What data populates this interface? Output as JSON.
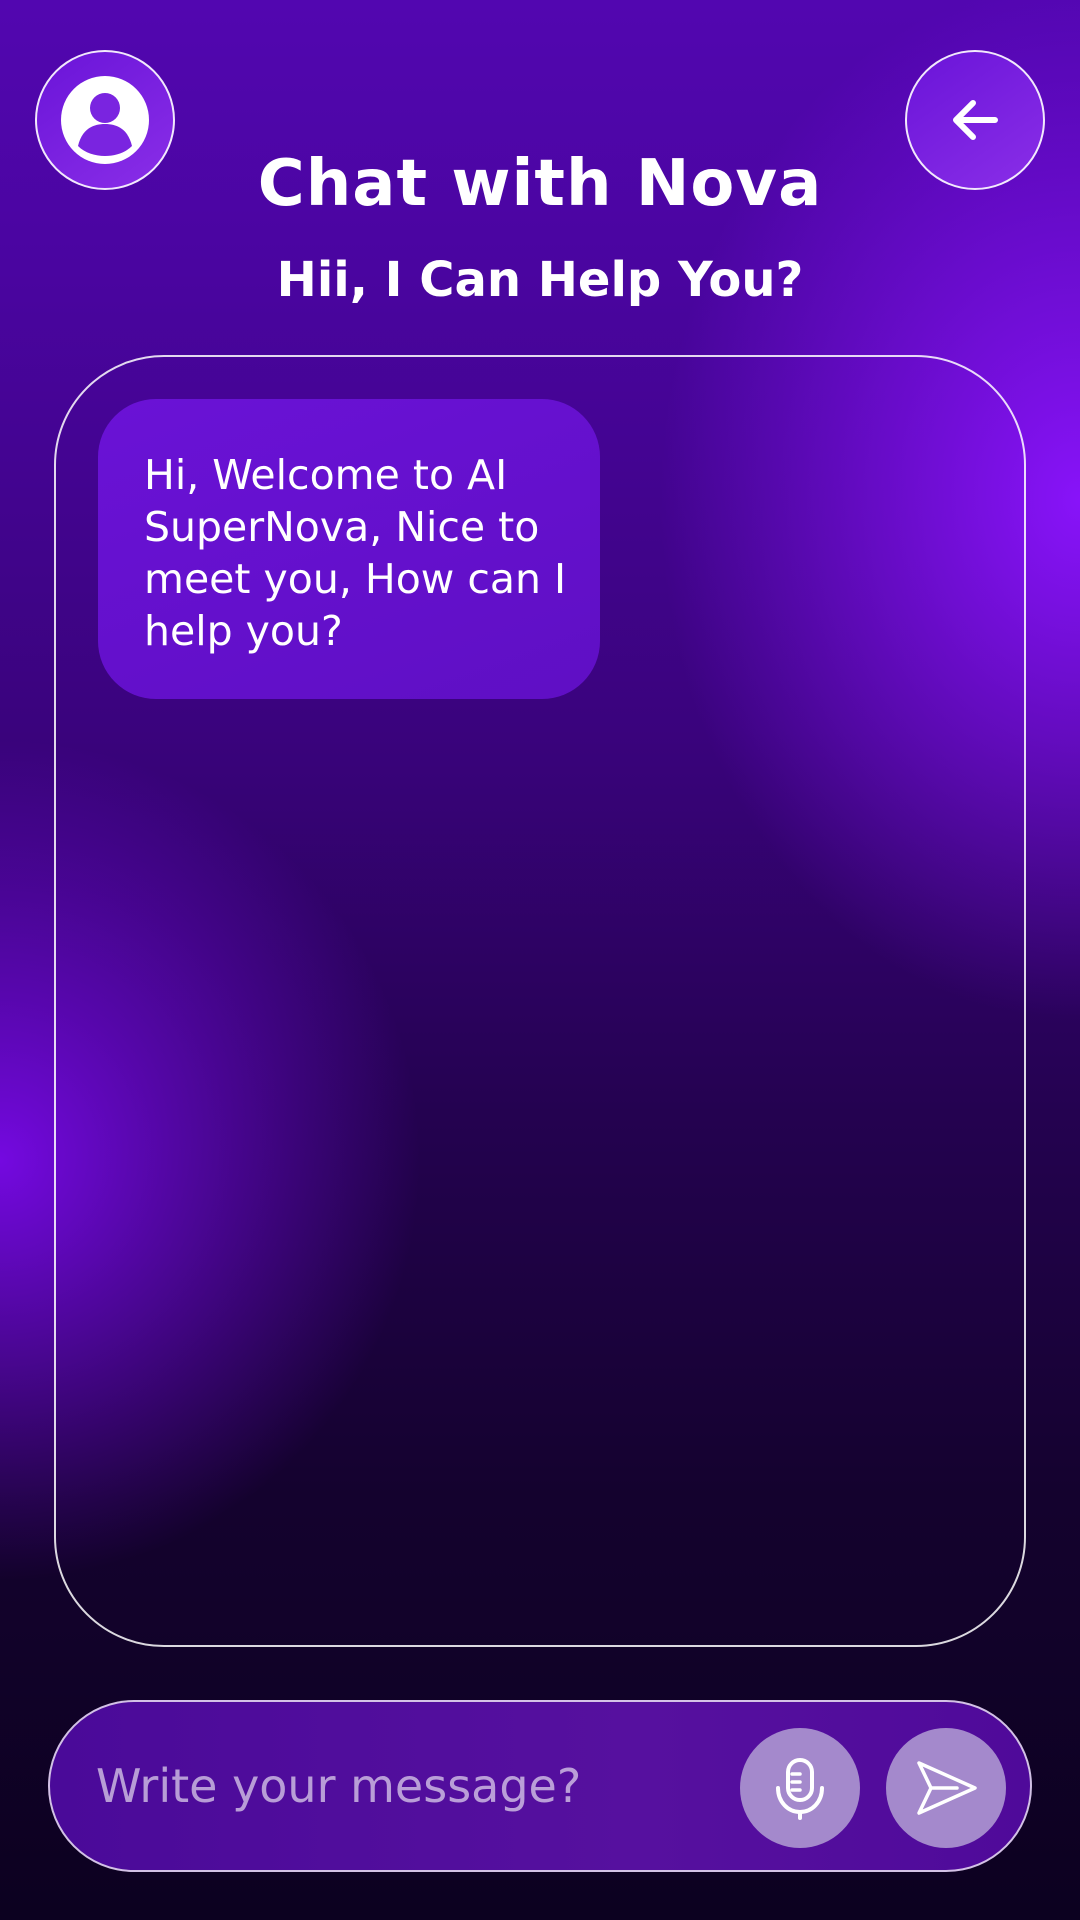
{
  "header": {
    "title": "Chat with Nova",
    "subtitle": "Hii, I Can Help You?",
    "profile_icon": "user-circle-icon",
    "back_icon": "arrow-left-icon"
  },
  "chat": {
    "messages": [
      {
        "sender": "bot",
        "text": "Hi, Welcome to AI SuperNova, Nice to meet you, How can I help you?"
      }
    ]
  },
  "composer": {
    "placeholder": "Write your message?",
    "value": "",
    "mic_icon": "microphone-icon",
    "send_icon": "send-icon"
  },
  "colors": {
    "accent": "#6a12d6",
    "background_top": "#5206b0",
    "background_bottom": "#0c0120",
    "action_button": "#a489cc"
  }
}
